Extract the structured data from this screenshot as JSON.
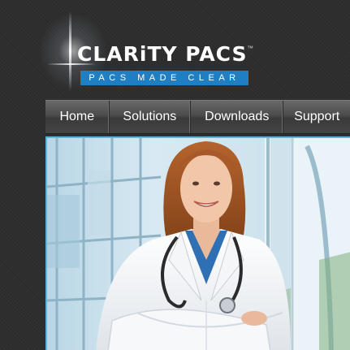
{
  "brand": {
    "name": "CLARiTY PACS",
    "trademark": "™",
    "tagline": "PACS MADE CLEAR",
    "colors": {
      "tagline_bg": "#1f7fc2",
      "accent": "#5fb3d6"
    }
  },
  "nav": {
    "items": [
      {
        "label": "Home"
      },
      {
        "label": "Solutions"
      },
      {
        "label": "Downloads"
      },
      {
        "label": "Support"
      }
    ]
  },
  "hero": {
    "image": "doctor-photo"
  }
}
